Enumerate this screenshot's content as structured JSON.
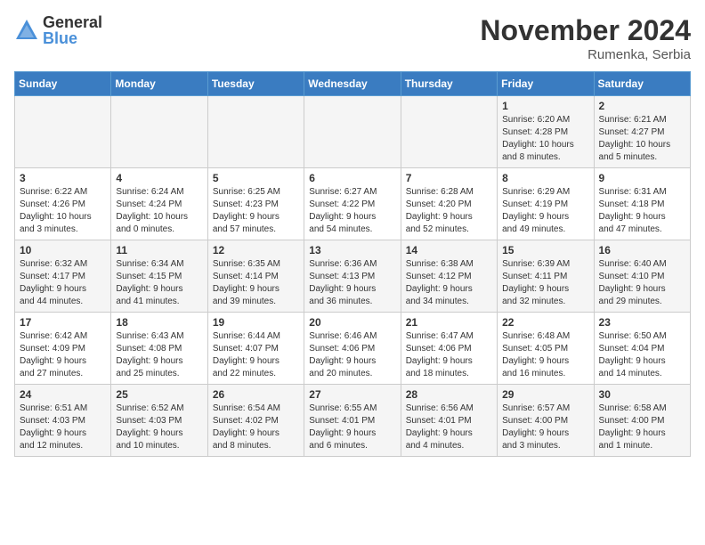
{
  "logo": {
    "general": "General",
    "blue": "Blue"
  },
  "header": {
    "month": "November 2024",
    "location": "Rumenka, Serbia"
  },
  "weekdays": [
    "Sunday",
    "Monday",
    "Tuesday",
    "Wednesday",
    "Thursday",
    "Friday",
    "Saturday"
  ],
  "weeks": [
    [
      {
        "day": "",
        "info": ""
      },
      {
        "day": "",
        "info": ""
      },
      {
        "day": "",
        "info": ""
      },
      {
        "day": "",
        "info": ""
      },
      {
        "day": "",
        "info": ""
      },
      {
        "day": "1",
        "info": "Sunrise: 6:20 AM\nSunset: 4:28 PM\nDaylight: 10 hours\nand 8 minutes."
      },
      {
        "day": "2",
        "info": "Sunrise: 6:21 AM\nSunset: 4:27 PM\nDaylight: 10 hours\nand 5 minutes."
      }
    ],
    [
      {
        "day": "3",
        "info": "Sunrise: 6:22 AM\nSunset: 4:26 PM\nDaylight: 10 hours\nand 3 minutes."
      },
      {
        "day": "4",
        "info": "Sunrise: 6:24 AM\nSunset: 4:24 PM\nDaylight: 10 hours\nand 0 minutes."
      },
      {
        "day": "5",
        "info": "Sunrise: 6:25 AM\nSunset: 4:23 PM\nDaylight: 9 hours\nand 57 minutes."
      },
      {
        "day": "6",
        "info": "Sunrise: 6:27 AM\nSunset: 4:22 PM\nDaylight: 9 hours\nand 54 minutes."
      },
      {
        "day": "7",
        "info": "Sunrise: 6:28 AM\nSunset: 4:20 PM\nDaylight: 9 hours\nand 52 minutes."
      },
      {
        "day": "8",
        "info": "Sunrise: 6:29 AM\nSunset: 4:19 PM\nDaylight: 9 hours\nand 49 minutes."
      },
      {
        "day": "9",
        "info": "Sunrise: 6:31 AM\nSunset: 4:18 PM\nDaylight: 9 hours\nand 47 minutes."
      }
    ],
    [
      {
        "day": "10",
        "info": "Sunrise: 6:32 AM\nSunset: 4:17 PM\nDaylight: 9 hours\nand 44 minutes."
      },
      {
        "day": "11",
        "info": "Sunrise: 6:34 AM\nSunset: 4:15 PM\nDaylight: 9 hours\nand 41 minutes."
      },
      {
        "day": "12",
        "info": "Sunrise: 6:35 AM\nSunset: 4:14 PM\nDaylight: 9 hours\nand 39 minutes."
      },
      {
        "day": "13",
        "info": "Sunrise: 6:36 AM\nSunset: 4:13 PM\nDaylight: 9 hours\nand 36 minutes."
      },
      {
        "day": "14",
        "info": "Sunrise: 6:38 AM\nSunset: 4:12 PM\nDaylight: 9 hours\nand 34 minutes."
      },
      {
        "day": "15",
        "info": "Sunrise: 6:39 AM\nSunset: 4:11 PM\nDaylight: 9 hours\nand 32 minutes."
      },
      {
        "day": "16",
        "info": "Sunrise: 6:40 AM\nSunset: 4:10 PM\nDaylight: 9 hours\nand 29 minutes."
      }
    ],
    [
      {
        "day": "17",
        "info": "Sunrise: 6:42 AM\nSunset: 4:09 PM\nDaylight: 9 hours\nand 27 minutes."
      },
      {
        "day": "18",
        "info": "Sunrise: 6:43 AM\nSunset: 4:08 PM\nDaylight: 9 hours\nand 25 minutes."
      },
      {
        "day": "19",
        "info": "Sunrise: 6:44 AM\nSunset: 4:07 PM\nDaylight: 9 hours\nand 22 minutes."
      },
      {
        "day": "20",
        "info": "Sunrise: 6:46 AM\nSunset: 4:06 PM\nDaylight: 9 hours\nand 20 minutes."
      },
      {
        "day": "21",
        "info": "Sunrise: 6:47 AM\nSunset: 4:06 PM\nDaylight: 9 hours\nand 18 minutes."
      },
      {
        "day": "22",
        "info": "Sunrise: 6:48 AM\nSunset: 4:05 PM\nDaylight: 9 hours\nand 16 minutes."
      },
      {
        "day": "23",
        "info": "Sunrise: 6:50 AM\nSunset: 4:04 PM\nDaylight: 9 hours\nand 14 minutes."
      }
    ],
    [
      {
        "day": "24",
        "info": "Sunrise: 6:51 AM\nSunset: 4:03 PM\nDaylight: 9 hours\nand 12 minutes."
      },
      {
        "day": "25",
        "info": "Sunrise: 6:52 AM\nSunset: 4:03 PM\nDaylight: 9 hours\nand 10 minutes."
      },
      {
        "day": "26",
        "info": "Sunrise: 6:54 AM\nSunset: 4:02 PM\nDaylight: 9 hours\nand 8 minutes."
      },
      {
        "day": "27",
        "info": "Sunrise: 6:55 AM\nSunset: 4:01 PM\nDaylight: 9 hours\nand 6 minutes."
      },
      {
        "day": "28",
        "info": "Sunrise: 6:56 AM\nSunset: 4:01 PM\nDaylight: 9 hours\nand 4 minutes."
      },
      {
        "day": "29",
        "info": "Sunrise: 6:57 AM\nSunset: 4:00 PM\nDaylight: 9 hours\nand 3 minutes."
      },
      {
        "day": "30",
        "info": "Sunrise: 6:58 AM\nSunset: 4:00 PM\nDaylight: 9 hours\nand 1 minute."
      }
    ]
  ]
}
